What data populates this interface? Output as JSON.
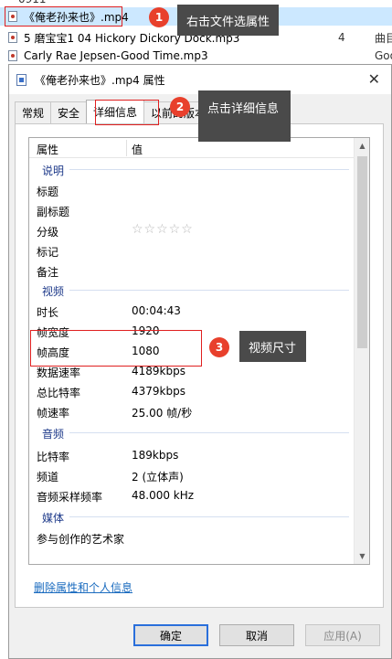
{
  "file_list": {
    "folder_partial": "0911",
    "rows": [
      {
        "name": "《俺老孙来也》.mp4",
        "num": "",
        "album": ""
      },
      {
        "name": "5 磨宝宝1 04 Hickory Dickory Dock.mp3",
        "num": "4",
        "album": "曲目"
      },
      {
        "name": "Carly Rae Jepsen-Good Time.mp3",
        "num": "",
        "album": "Goo"
      }
    ]
  },
  "callouts": [
    {
      "badge": "1",
      "text": "右击文件选属性"
    },
    {
      "badge": "2",
      "text": "点击详细信息"
    },
    {
      "badge": "3",
      "text": "视频尺寸"
    }
  ],
  "dialog": {
    "title": "《俺老孙来也》.mp4 属性",
    "close_glyph": "✕",
    "tabs": [
      "常规",
      "安全",
      "详细信息",
      "以前的版本"
    ],
    "active_tab": "详细信息",
    "header": {
      "col_property": "属性",
      "col_value": "值"
    },
    "groups": {
      "desc": "说明",
      "video": "视频",
      "audio": "音频",
      "media": "媒体"
    },
    "props": {
      "title": {
        "name": "标题",
        "value": ""
      },
      "subtitle": {
        "name": "副标题",
        "value": ""
      },
      "rating": {
        "name": "分级",
        "value": "☆☆☆☆☆"
      },
      "tags": {
        "name": "标记",
        "value": ""
      },
      "comments": {
        "name": "备注",
        "value": ""
      },
      "length": {
        "name": "时长",
        "value": "00:04:43"
      },
      "width": {
        "name": "帧宽度",
        "value": "1920"
      },
      "height": {
        "name": "帧高度",
        "value": "1080"
      },
      "datarate": {
        "name": "数据速率",
        "value": "4189kbps"
      },
      "totalbitrate": {
        "name": "总比特率",
        "value": "4379kbps"
      },
      "framerate": {
        "name": "帧速率",
        "value": "25.00 帧/秒"
      },
      "bitrate": {
        "name": "比特率",
        "value": "189kbps"
      },
      "channels": {
        "name": "频道",
        "value": "2 (立体声)"
      },
      "samplerate": {
        "name": "音频采样频率",
        "value": "48.000 kHz"
      },
      "contrib": {
        "name": "参与创作的艺术家",
        "value": ""
      }
    },
    "remove_link": "删除属性和个人信息",
    "buttons": {
      "ok": "确定",
      "cancel": "取消",
      "apply": "应用(A)"
    }
  },
  "colors": {
    "accent": "#2a6fdb",
    "badge": "#e8402c",
    "callout_bg": "#4a4a4a",
    "highlight": "#e02020"
  }
}
